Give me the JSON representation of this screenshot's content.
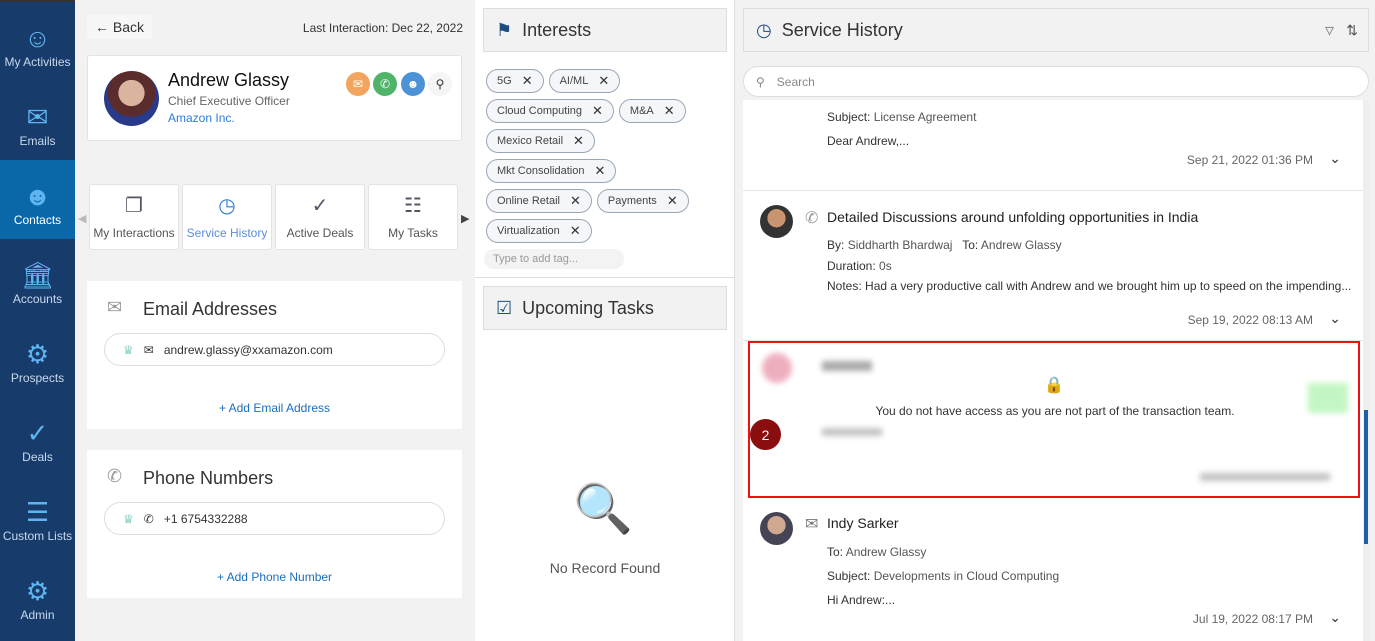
{
  "sidebar": {
    "items": [
      {
        "label": "My Activities",
        "icon": "user-check-icon"
      },
      {
        "label": "Emails",
        "icon": "envelope-icon"
      },
      {
        "label": "Contacts",
        "icon": "user-icon",
        "active": true
      },
      {
        "label": "Accounts",
        "icon": "bank-icon"
      },
      {
        "label": "Prospects",
        "icon": "chart-icon"
      },
      {
        "label": "Deals",
        "icon": "handshake-icon"
      },
      {
        "label": "Custom Lists",
        "icon": "list-icon"
      },
      {
        "label": "Admin",
        "icon": "user-gear-icon"
      }
    ]
  },
  "header": {
    "back_label": "Back",
    "last_interaction": "Last Interaction: Dec 22, 2022"
  },
  "contact": {
    "name": "Andrew Glassy",
    "title": "Chief Executive Officer",
    "company": "Amazon Inc."
  },
  "tabs": [
    {
      "label": "My Interactions"
    },
    {
      "label": "Service History",
      "active": true
    },
    {
      "label": "Active Deals"
    },
    {
      "label": "My Tasks"
    }
  ],
  "emails": {
    "title": "Email Addresses",
    "value": "andrew.glassy@xxamazon.com",
    "add_label": "+ Add Email Address"
  },
  "phones": {
    "title": "Phone Numbers",
    "value": "+1 6754332288",
    "add_label": "+ Add Phone Number"
  },
  "interests": {
    "title": "Interests",
    "tags": [
      "5G",
      "AI/ML",
      "Cloud Computing",
      "M&A",
      "Mexico Retail",
      "Mkt Consolidation",
      "Online Retail",
      "Payments",
      "Virtualization"
    ],
    "placeholder": "Type to add tag..."
  },
  "tasks": {
    "title": "Upcoming Tasks",
    "empty": "No Record Found"
  },
  "service_history": {
    "title": "Service History",
    "search_placeholder": "Search",
    "items": [
      {
        "subject_label": "Subject:",
        "subject": "License Agreement",
        "body": "Dear Andrew,...",
        "date": "Sep 21, 2022 01:36 PM"
      },
      {
        "title": "Detailed Discussions around unfolding opportunities in India",
        "by_label": "By:",
        "by": "Siddharth Bhardwaj",
        "to_label": "To:",
        "to": "Andrew Glassy",
        "duration_label": "Duration:",
        "duration": "0s",
        "notes_label": "Notes:",
        "notes": "Had a very productive call with Andrew and we brought him up to speed on the impending...",
        "date": "Sep 19, 2022 08:13 AM"
      },
      {
        "restricted_message": "You do not have access as you are not part of the transaction team.",
        "badge": "2"
      },
      {
        "title": "Indy Sarker",
        "to_label": "To:",
        "to": "Andrew Glassy",
        "subject_label": "Subject:",
        "subject": "Developments in Cloud Computing",
        "body": "Hi Andrew:...",
        "date": "Jul 19, 2022 08:17 PM"
      }
    ]
  },
  "colors": {
    "sidebar": "#173b6a",
    "active": "#0a68a8",
    "link": "#1a6fc0",
    "highlight": "#e11111",
    "badge": "#8b0e0e"
  }
}
